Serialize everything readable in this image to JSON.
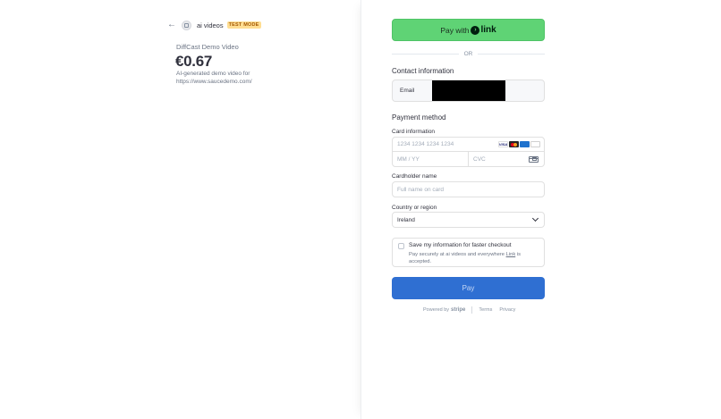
{
  "summary": {
    "business_name": "ai videos",
    "test_badge": "TEST MODE",
    "product_name": "DiffCast Demo Video",
    "price": "€0.67",
    "description": "AI-generated demo video for https://www.saucedemo.com/"
  },
  "express": {
    "pay_with_label": "Pay with",
    "link_word": "link",
    "or_label": "OR"
  },
  "contact": {
    "title": "Contact information",
    "email_label": "Email"
  },
  "payment": {
    "title": "Payment method",
    "card_label": "Card information",
    "card_placeholder": "1234 1234 1234 1234",
    "expiry_placeholder": "MM / YY",
    "cvc_placeholder": "CVC",
    "brands": [
      "VISA",
      "MC",
      "AMEX",
      "JCB"
    ],
    "holder_label": "Cardholder name",
    "holder_placeholder": "Full name on card",
    "country_label": "Country or region",
    "country_value": "Ireland"
  },
  "save": {
    "title": "Save my information for faster checkout",
    "desc_prefix": "Pay securely at ai videos and everywhere ",
    "desc_link": "Link",
    "desc_suffix": " is accepted."
  },
  "pay_button": "Pay",
  "footer": {
    "powered": "Powered by",
    "stripe": "stripe",
    "terms": "Terms",
    "privacy": "Privacy"
  },
  "colors": {
    "link_green": "#5fd375",
    "pay_blue": "#2f6fd2",
    "test_badge": "#ffde92"
  }
}
